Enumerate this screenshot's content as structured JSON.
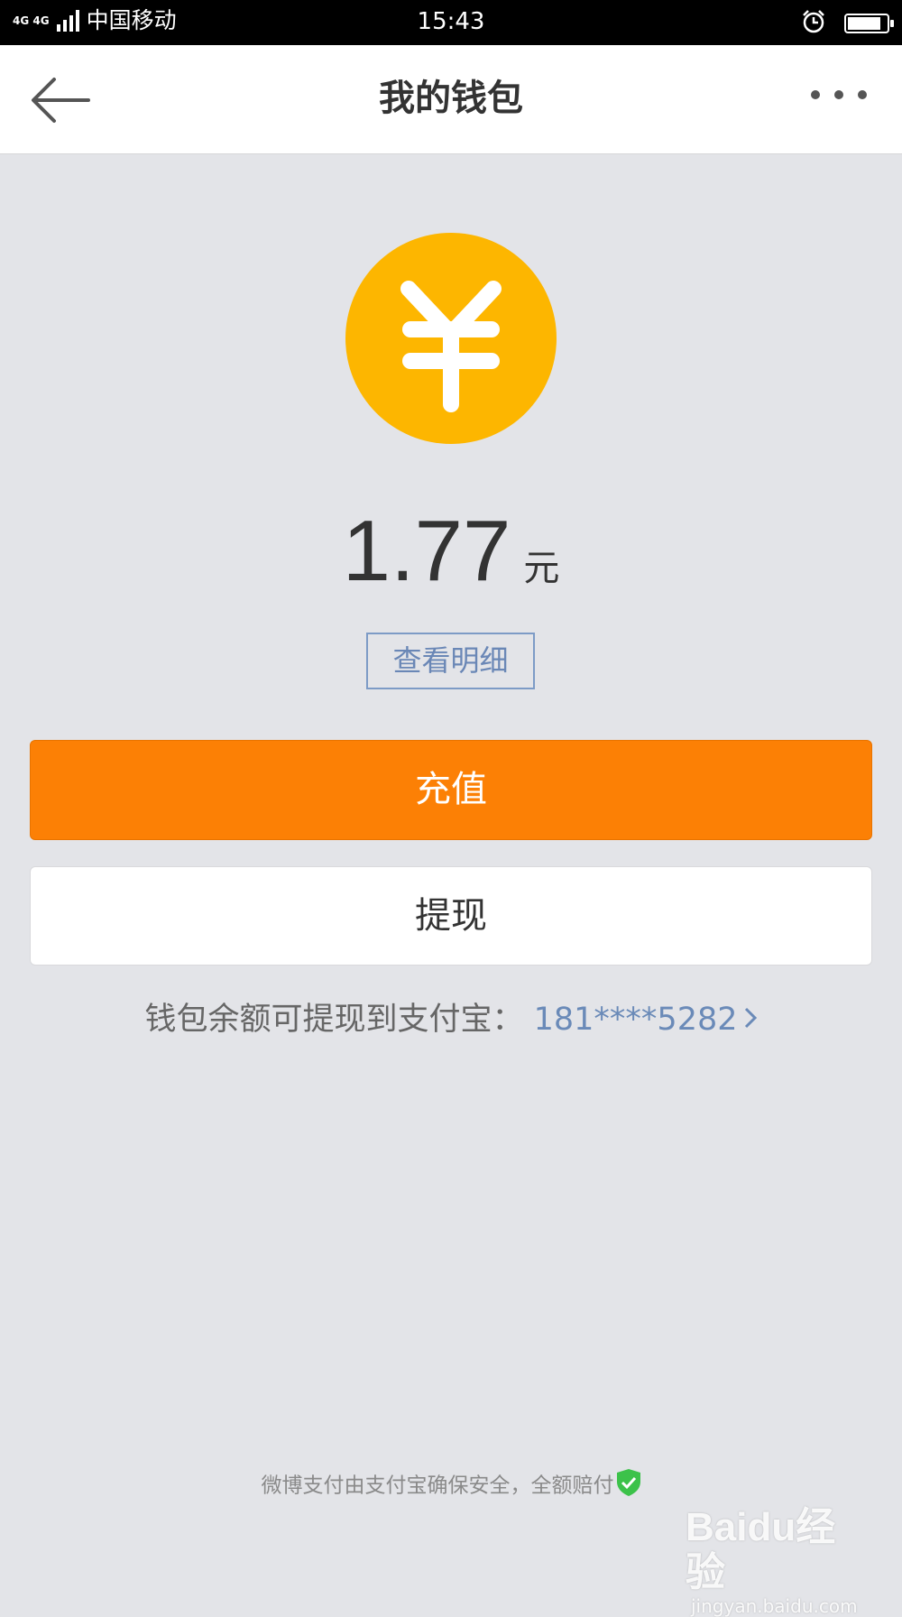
{
  "status_bar": {
    "network": "4G 4G",
    "carrier": "中国移动",
    "time": "15:43",
    "battery_level": 0.85
  },
  "nav": {
    "title": "我的钱包"
  },
  "wallet": {
    "currency_symbol": "¥",
    "balance": "1.77",
    "unit": "元",
    "detail_button": "查看明细",
    "recharge_button": "充值",
    "withdraw_button": "提现",
    "alipay_text": "钱包余额可提现到支付宝：",
    "alipay_account": "181****5282"
  },
  "footer": {
    "security_note": "微博支付由支付宝确保安全，全额赔付"
  },
  "watermark": {
    "logo": "Baidu经验",
    "url": "jingyan.baidu.com"
  },
  "colors": {
    "background": "#e3e4e8",
    "coin": "#fdb600",
    "recharge": "#fc8005",
    "link": "#6a8ab8",
    "shield": "#3cc24a"
  }
}
